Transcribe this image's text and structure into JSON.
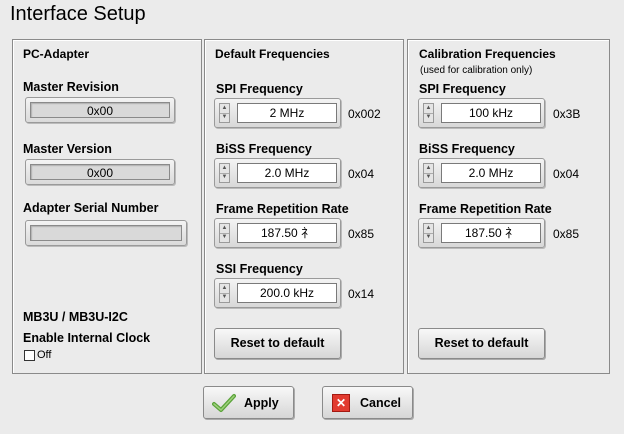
{
  "title": "Interface Setup",
  "pc_adapter": {
    "title": "PC-Adapter",
    "master_revision_label": "Master Revision",
    "master_revision_value": "0x00",
    "master_version_label": "Master Version",
    "master_version_value": "0x00",
    "serial_label": "Adapter Serial Number",
    "serial_value": "",
    "mb3u_label": "MB3U / MB3U-I2C",
    "clock_label": "Enable Internal Clock",
    "clock_checkbox_label": "Off"
  },
  "default_freq": {
    "title": "Default Frequencies",
    "spi_label": "SPI Frequency",
    "spi_value": "2 MHz",
    "spi_hex": "0x002",
    "biss_label": "BiSS Frequency",
    "biss_value": "2.0 MHz",
    "biss_hex": "0x04",
    "frame_label": "Frame Repetition Rate",
    "frame_value": "187.50 礻",
    "frame_hex": "0x85",
    "ssi_label": "SSI Frequency",
    "ssi_value": "200.0 kHz",
    "ssi_hex": "0x14",
    "reset_label": "Reset to default"
  },
  "calib_freq": {
    "title": "Calibration Frequencies",
    "subtitle": "(used for calibration only)",
    "spi_label": "SPI Frequency",
    "spi_value": "100 kHz",
    "spi_hex": "0x3B",
    "biss_label": "BiSS Frequency",
    "biss_value": "2.0 MHz",
    "biss_hex": "0x04",
    "frame_label": "Frame Repetition Rate",
    "frame_value": "187.50 礻",
    "frame_hex": "0x85",
    "reset_label": "Reset to default"
  },
  "buttons": {
    "apply_label": "Apply",
    "cancel_label": "Cancel"
  },
  "icons": {
    "apply": "checkmark-icon",
    "cancel": "close-icon"
  },
  "colors": {
    "background": "#ebebeb",
    "cancel_icon": "#e23a2f",
    "apply_icon": "#5aa33a"
  }
}
